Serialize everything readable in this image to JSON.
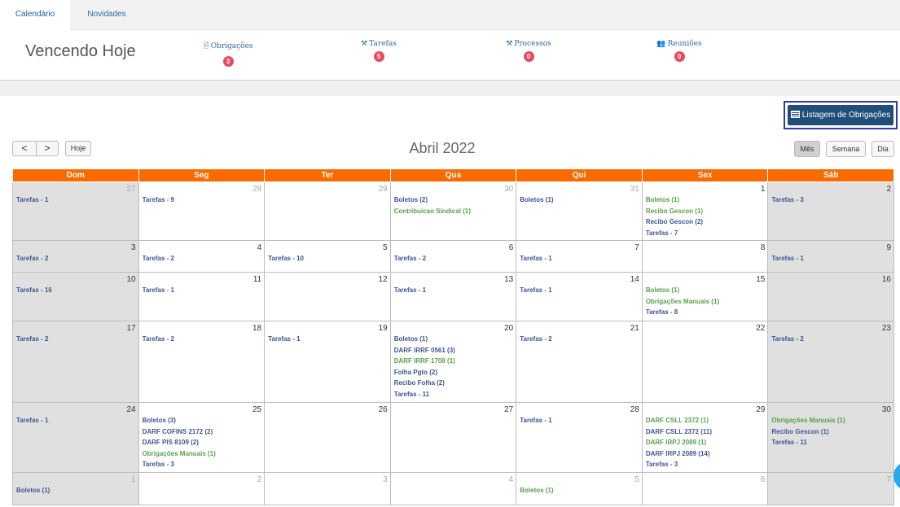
{
  "tabs": [
    {
      "label": "Calendário"
    },
    {
      "label": "Novidades"
    }
  ],
  "vencendo": {
    "title": "Vencendo Hoje",
    "items": [
      {
        "icon": "document-icon",
        "label": "Obrigações",
        "count": "3"
      },
      {
        "icon": "hammer-icon",
        "label": "Tarefas",
        "count": "5"
      },
      {
        "icon": "hammer-icon",
        "label": "Processos",
        "count": "0"
      },
      {
        "icon": "users-icon",
        "label": "Reuniões",
        "count": "0"
      }
    ]
  },
  "toolbar": {
    "list_button": "Listagem de Obrigações",
    "prev": "<",
    "next": ">",
    "today": "Hoje",
    "month_title": "Abril 2022",
    "views": [
      "Mês",
      "Semana",
      "Dia"
    ]
  },
  "colors": {
    "header": "#f96a00",
    "event_blue": "#3e5594",
    "event_green": "#58a04b",
    "badge": "#e84a5f",
    "button": "#1f4e79"
  },
  "calendar": {
    "days": [
      "Dom",
      "Seg",
      "Ter",
      "Qua",
      "Qui",
      "Sex",
      "Sáb"
    ],
    "weeks": [
      {
        "cells": [
          {
            "day": "27",
            "other": true,
            "events": [
              {
                "t": "Tarefas - 1",
                "c": "blue"
              }
            ]
          },
          {
            "day": "28",
            "other": true,
            "events": [
              {
                "t": "Tarefas - 9",
                "c": "blue"
              }
            ]
          },
          {
            "day": "29",
            "other": true,
            "events": []
          },
          {
            "day": "30",
            "other": true,
            "events": [
              {
                "t": "Boletos (2)",
                "c": "blue"
              },
              {
                "t": "Contribuicao Sindical (1)",
                "c": "green"
              }
            ]
          },
          {
            "day": "31",
            "other": true,
            "events": [
              {
                "t": "Boletos (1)",
                "c": "blue"
              }
            ]
          },
          {
            "day": "1",
            "other": false,
            "events": [
              {
                "t": "Boletos (1)",
                "c": "green"
              },
              {
                "t": "Recibo Gescon (1)",
                "c": "green"
              },
              {
                "t": "Recibo Gescon (2)",
                "c": "blue"
              },
              {
                "t": "Tarefas - 7",
                "c": "blue"
              }
            ]
          },
          {
            "day": "2",
            "other": false,
            "events": [
              {
                "t": "Tarefas - 3",
                "c": "blue"
              }
            ]
          }
        ]
      },
      {
        "cells": [
          {
            "day": "3",
            "other": false,
            "events": [
              {
                "t": "Tarefas - 2",
                "c": "blue"
              }
            ]
          },
          {
            "day": "4",
            "other": false,
            "events": [
              {
                "t": "Tarefas - 2",
                "c": "blue"
              }
            ]
          },
          {
            "day": "5",
            "other": false,
            "events": [
              {
                "t": "Tarefas - 10",
                "c": "blue"
              }
            ]
          },
          {
            "day": "6",
            "other": false,
            "events": [
              {
                "t": "Tarefas - 2",
                "c": "blue"
              }
            ]
          },
          {
            "day": "7",
            "other": false,
            "events": [
              {
                "t": "Tarefas - 1",
                "c": "blue"
              }
            ]
          },
          {
            "day": "8",
            "other": false,
            "events": []
          },
          {
            "day": "9",
            "other": false,
            "events": [
              {
                "t": "Tarefas - 1",
                "c": "blue"
              }
            ]
          }
        ]
      },
      {
        "cells": [
          {
            "day": "10",
            "other": false,
            "events": [
              {
                "t": "Tarefas - 16",
                "c": "blue"
              }
            ]
          },
          {
            "day": "11",
            "other": false,
            "events": [
              {
                "t": "Tarefas - 1",
                "c": "blue"
              }
            ]
          },
          {
            "day": "12",
            "other": false,
            "events": []
          },
          {
            "day": "13",
            "other": false,
            "events": [
              {
                "t": "Tarefas - 1",
                "c": "blue"
              }
            ]
          },
          {
            "day": "14",
            "other": false,
            "events": [
              {
                "t": "Tarefas - 1",
                "c": "blue"
              }
            ]
          },
          {
            "day": "15",
            "other": false,
            "events": [
              {
                "t": "Boletos (1)",
                "c": "green"
              },
              {
                "t": "Obrigações Manuais (1)",
                "c": "green"
              },
              {
                "t": "Tarefas - 8",
                "c": "blue"
              }
            ]
          },
          {
            "day": "16",
            "other": false,
            "events": []
          }
        ]
      },
      {
        "cells": [
          {
            "day": "17",
            "other": false,
            "events": [
              {
                "t": "Tarefas - 2",
                "c": "blue"
              }
            ]
          },
          {
            "day": "18",
            "other": false,
            "events": [
              {
                "t": "Tarefas - 2",
                "c": "blue"
              }
            ]
          },
          {
            "day": "19",
            "other": false,
            "events": [
              {
                "t": "Tarefas - 1",
                "c": "blue"
              }
            ]
          },
          {
            "day": "20",
            "other": false,
            "events": [
              {
                "t": "Boletos (1)",
                "c": "blue"
              },
              {
                "t": "DARF IRRF 0561 (3)",
                "c": "blue"
              },
              {
                "t": "DARF IRRF 1708 (1)",
                "c": "green"
              },
              {
                "t": "Folha Pgto (2)",
                "c": "blue"
              },
              {
                "t": "Recibo Folha (2)",
                "c": "blue"
              },
              {
                "t": "Tarefas - 11",
                "c": "blue"
              }
            ]
          },
          {
            "day": "21",
            "other": false,
            "events": [
              {
                "t": "Tarefas - 2",
                "c": "blue"
              }
            ]
          },
          {
            "day": "22",
            "other": false,
            "events": []
          },
          {
            "day": "23",
            "other": false,
            "events": [
              {
                "t": "Tarefas - 2",
                "c": "blue"
              }
            ]
          }
        ]
      },
      {
        "cells": [
          {
            "day": "24",
            "other": false,
            "events": [
              {
                "t": "Tarefas - 1",
                "c": "blue"
              }
            ]
          },
          {
            "day": "25",
            "other": false,
            "events": [
              {
                "t": "Boletos (3)",
                "c": "blue"
              },
              {
                "t": "DARF COFINS 2172 (2)",
                "c": "blue"
              },
              {
                "t": "DARF PIS 8109 (2)",
                "c": "blue"
              },
              {
                "t": "Obrigações Manuais (1)",
                "c": "green"
              },
              {
                "t": "Tarefas - 3",
                "c": "blue"
              }
            ]
          },
          {
            "day": "26",
            "other": false,
            "events": []
          },
          {
            "day": "27",
            "other": false,
            "events": []
          },
          {
            "day": "28",
            "other": false,
            "events": [
              {
                "t": "Tarefas - 1",
                "c": "blue"
              }
            ]
          },
          {
            "day": "29",
            "other": false,
            "events": [
              {
                "t": "DARF CSLL 2372 (1)",
                "c": "green"
              },
              {
                "t": "DARF CSLL 2372 (11)",
                "c": "blue"
              },
              {
                "t": "DARF IRPJ 2089 (1)",
                "c": "green"
              },
              {
                "t": "DARF IRPJ 2089 (14)",
                "c": "blue"
              },
              {
                "t": "Tarefas - 3",
                "c": "blue"
              }
            ]
          },
          {
            "day": "30",
            "other": false,
            "events": [
              {
                "t": "Obrigações Manuais (1)",
                "c": "green"
              },
              {
                "t": "Recibo Gescon (1)",
                "c": "blue"
              },
              {
                "t": "Tarefas - 11",
                "c": "blue"
              }
            ]
          }
        ]
      },
      {
        "cells": [
          {
            "day": "1",
            "other": true,
            "events": [
              {
                "t": "Boletos (1)",
                "c": "blue"
              }
            ]
          },
          {
            "day": "2",
            "other": true,
            "events": []
          },
          {
            "day": "3",
            "other": true,
            "events": []
          },
          {
            "day": "4",
            "other": true,
            "events": []
          },
          {
            "day": "5",
            "other": true,
            "events": [
              {
                "t": "Boletos (1)",
                "c": "green"
              }
            ]
          },
          {
            "day": "6",
            "other": true,
            "events": []
          },
          {
            "day": "7",
            "other": true,
            "events": []
          }
        ]
      }
    ]
  }
}
